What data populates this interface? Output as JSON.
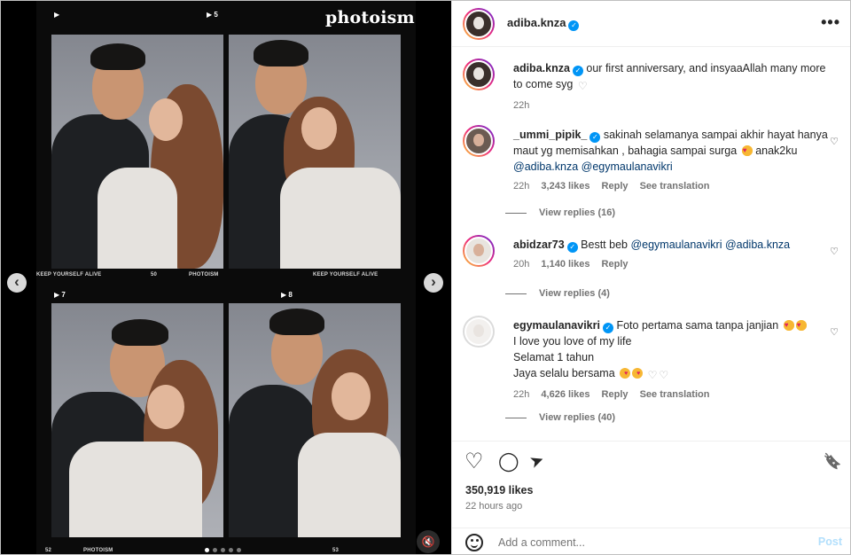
{
  "media": {
    "brand": "photoism",
    "frame_markers": [
      "▶",
      "▶ 5",
      "▶ 7",
      "▶ 8"
    ],
    "captions": [
      "KEEP YOURSELF ALIVE",
      "50",
      "PHOTOISM",
      "KEEP YOURSELF ALIVE",
      "52",
      "PHOTOISM",
      "53"
    ],
    "prev_arrow": "‹",
    "next_arrow": "›",
    "mute_icon": "🔇"
  },
  "header": {
    "username": "adiba.knza",
    "verified_mark": "✓",
    "more_icon": "•••"
  },
  "post_caption": {
    "username": "adiba.knza",
    "text": "our first anniversary, and insyaaAllah many more to come syg",
    "heart": "♡",
    "time": "22h"
  },
  "comments": [
    {
      "username": "_ummi_pipik_",
      "text": "sakinah selamanya sampai akhir hayat hanya maut yg memisahkan , bahagia sampai surga",
      "text_after_emoji": "anak2ku",
      "mentions": [
        "@adiba.knza",
        "@egymaulanavikri"
      ],
      "time": "22h",
      "likes": "3,243 likes",
      "reply": "Reply",
      "translation": "See translation",
      "view_replies": "View replies (16)"
    },
    {
      "username": "abidzar73",
      "text": "Bestt beb",
      "mentions": [
        "@egymaulanavikri",
        "@adiba.knza"
      ],
      "time": "20h",
      "likes": "1,140 likes",
      "reply": "Reply",
      "view_replies": "View replies (4)"
    },
    {
      "username": "egymaulanavikri",
      "line1": "Foto pertama sama tanpa janjian",
      "line2": "I love you love of my life",
      "line3": "Selamat 1 tahun",
      "line4": "Jaya selalu bersama",
      "time": "22h",
      "likes": "4,626 likes",
      "reply": "Reply",
      "translation": "See translation",
      "view_replies": "View replies (40)"
    }
  ],
  "actions": {
    "like_icon": "♡",
    "comment_icon": "◯",
    "share_icon": "➤",
    "save_icon": "🔖",
    "likes": "350,919 likes",
    "posted": "22 hours ago"
  },
  "composer": {
    "placeholder": "Add a comment...",
    "post_label": "Post"
  },
  "colors": {
    "verified": "#0095f6",
    "mention": "#00376b",
    "muted": "#737373",
    "post_disabled": "#b2dffc"
  }
}
